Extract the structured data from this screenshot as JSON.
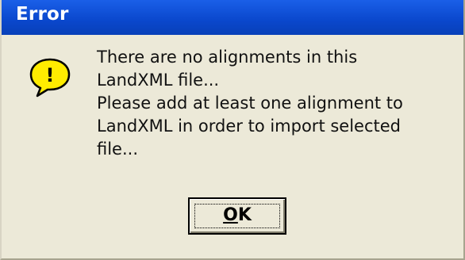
{
  "window": {
    "title": "Error",
    "titlebar_color": "#0a47cc",
    "background_color": "#ece9d8"
  },
  "icon": {
    "name": "warning-speech-bubble-icon",
    "glyph": "!",
    "color": "#ffec00"
  },
  "message": {
    "lines": [
      "There are no alignments in this",
      "LandXML file...",
      "Please add at least one alignment to",
      "LandXML in order to import selected",
      "file..."
    ]
  },
  "buttons": {
    "ok": {
      "mnemonic": "O",
      "rest": "K"
    }
  }
}
